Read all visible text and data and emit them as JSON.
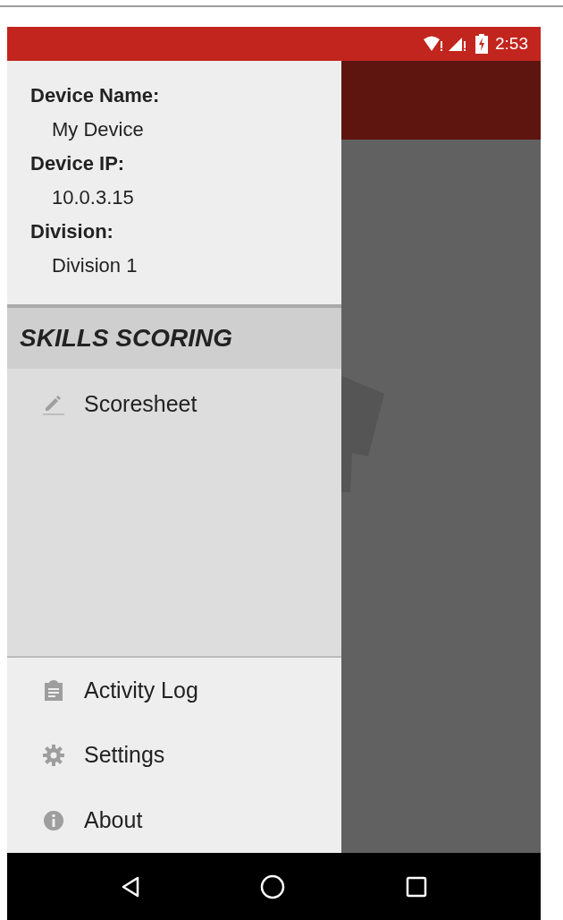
{
  "status_bar": {
    "time": "2:53"
  },
  "drawer": {
    "info": [
      {
        "label": "Device Name:",
        "value": "My Device"
      },
      {
        "label": "Device IP:",
        "value": "10.0.3.15"
      },
      {
        "label": "Division:",
        "value": "Division 1"
      }
    ],
    "section": {
      "title": "SKILLS SCORING",
      "items": [
        {
          "label": "Scoresheet",
          "kind": "pencil"
        }
      ]
    },
    "footer_items": [
      {
        "label": "Activity Log",
        "kind": "clipboard"
      },
      {
        "label": "Settings",
        "kind": "gear"
      },
      {
        "label": "About",
        "kind": "info"
      }
    ]
  }
}
